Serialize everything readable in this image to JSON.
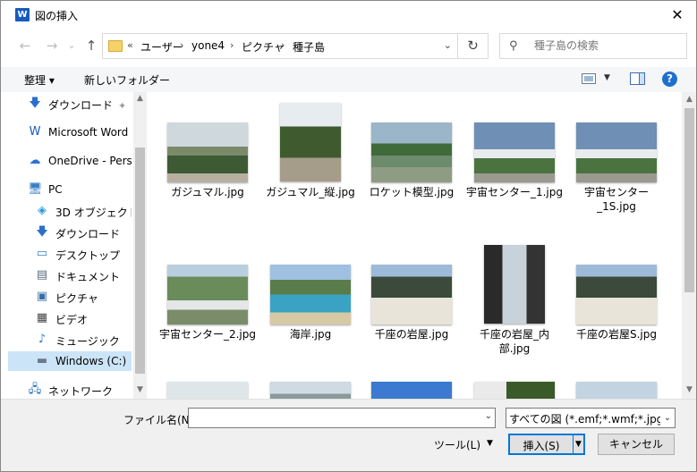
{
  "window": {
    "title": "図の挿入",
    "close_glyph": "✕",
    "app_icon_letter": "W"
  },
  "nav": {
    "back_glyph": "←",
    "forward_glyph": "→",
    "recent_glyph": "⌄",
    "up_glyph": "↑",
    "address": {
      "overflow": "«",
      "crumbs": [
        "ユーザー",
        "yone4",
        "ピクチャ",
        "種子島"
      ],
      "separator": "›",
      "dropdown_glyph": "⌄"
    },
    "refresh_glyph": "↻",
    "search": {
      "icon": "⚲",
      "placeholder": "種子島の検索"
    }
  },
  "toolbar": {
    "organize_label": "整理 ▾",
    "new_folder_label": "新しいフォルダー",
    "help_label": "?"
  },
  "sidebar": {
    "items": [
      {
        "label": "ダウンロード",
        "icon": "download-icon",
        "glyph": "🡇",
        "color": "#2a6fce"
      },
      {
        "label": "Microsoft Word",
        "icon": "word-icon",
        "glyph": "W",
        "color": "#185abd"
      },
      {
        "label": "OneDrive - Personal",
        "icon": "cloud-icon",
        "glyph": "☁",
        "color": "#2a72d6"
      },
      {
        "label": "PC",
        "icon": "pc-icon",
        "glyph": "🖥",
        "color": "#3b82c4"
      },
      {
        "label": "3D オブジェクト",
        "icon": "cube-icon",
        "glyph": "◈",
        "color": "#2a9bd8"
      },
      {
        "label": "ダウンロード",
        "icon": "download-icon",
        "glyph": "🡇",
        "color": "#2a6fce"
      },
      {
        "label": "デスクトップ",
        "icon": "desktop-icon",
        "glyph": "▭",
        "color": "#3a7fd0"
      },
      {
        "label": "ドキュメント",
        "icon": "document-icon",
        "glyph": "▤",
        "color": "#5a6b7c"
      },
      {
        "label": "ピクチャ",
        "icon": "pictures-icon",
        "glyph": "▣",
        "color": "#3a6fa6"
      },
      {
        "label": "ビデオ",
        "icon": "video-icon",
        "glyph": "▦",
        "color": "#444444"
      },
      {
        "label": "ミュージック",
        "icon": "music-icon",
        "glyph": "♪",
        "color": "#2a80d6"
      },
      {
        "label": "Windows (C:)",
        "icon": "drive-icon",
        "glyph": "▬",
        "color": "#6b7b8b"
      },
      {
        "label": "ネットワーク",
        "icon": "network-icon",
        "glyph": "🖧",
        "color": "#2a72c6"
      }
    ],
    "pin_glyph": "📌",
    "scroll_up": "▲",
    "scroll_down": "▼"
  },
  "files": [
    {
      "label": "ガジュマル.jpg"
    },
    {
      "label": "ガジュマル_縦.jpg"
    },
    {
      "label": "ロケット模型.jpg"
    },
    {
      "label": "宇宙センター_1.jpg"
    },
    {
      "label": "宇宙センター_1S.jpg"
    },
    {
      "label": "宇宙センター_2.jpg"
    },
    {
      "label": "海岸.jpg"
    },
    {
      "label": "千座の岩屋.jpg"
    },
    {
      "label": "千座の岩屋_内部.jpg"
    },
    {
      "label": "千座の岩屋S.jpg"
    },
    {
      "label": ""
    },
    {
      "label": ""
    },
    {
      "label": ""
    },
    {
      "label": ""
    },
    {
      "label": ""
    }
  ],
  "bottom": {
    "filename_label": "ファイル名(N):",
    "filename_value": "",
    "filter_value": "すべての図 (*.emf;*.wmf;*.jpg;*.jp",
    "tools_label": "ツール(L)",
    "insert_label": "挿入(S)",
    "cancel_label": "キャンセル",
    "caret_glyph": "▾"
  },
  "colors": {
    "accent": "#0078d7",
    "selected_bg": "#cce4f7"
  }
}
